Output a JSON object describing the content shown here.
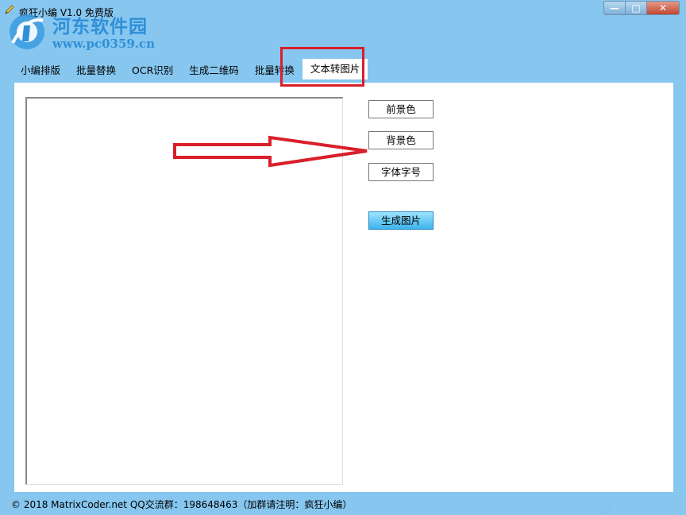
{
  "window": {
    "title": "疯狂小编 V1.0 免费版",
    "min_glyph": "—",
    "max_glyph": "□",
    "close_glyph": "✕"
  },
  "watermark": {
    "name": "河东软件园",
    "url": "www.pc0359.cn"
  },
  "tabs": [
    {
      "label": "小编排版"
    },
    {
      "label": "批量替换"
    },
    {
      "label": "OCR识别"
    },
    {
      "label": "生成二维码"
    },
    {
      "label": "批量转换"
    },
    {
      "label": "文本转图片",
      "active": true
    }
  ],
  "editor": {
    "value": ""
  },
  "buttons": {
    "foreground": "前景色",
    "background": "背景色",
    "font": "字体字号",
    "generate": "生成图片"
  },
  "status": {
    "text": "© 2018 MatrixCoder.net    QQ交流群：198648463（加群请注明：疯狂小编）"
  },
  "colors": {
    "frame": "#86c6ef",
    "highlight": "#d81f2a",
    "primary_button": "#3cb4ec"
  }
}
